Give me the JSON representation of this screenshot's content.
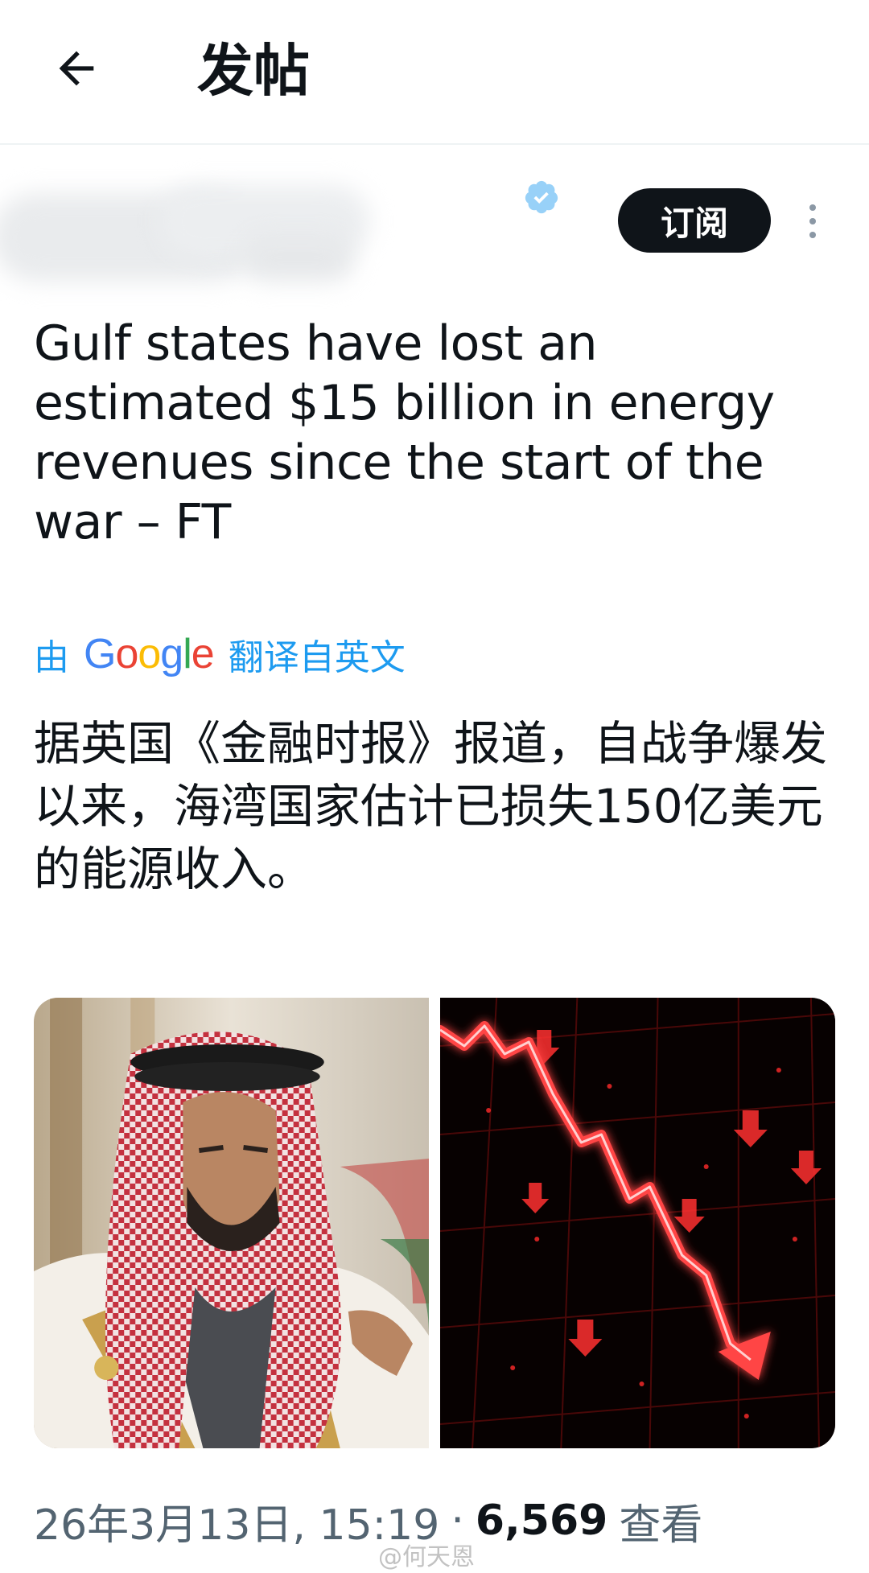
{
  "header": {
    "title": "发帖",
    "back_icon": "arrow-left-icon"
  },
  "author": {
    "subscribe_label": "订阅",
    "more_icon": "more-vertical-icon",
    "verified_icon": "verified-badge-icon"
  },
  "tweet": {
    "text": "Gulf states have lost an estimated $15 billion in energy revenues since the start of the war – FT",
    "translation_prefix": "由",
    "translation_provider": "Google",
    "translation_suffix": "翻译自英文",
    "translated_text": "据英国《金融时报》报道，自战争爆发以来，海湾国家估计已损失150亿美元的能源收入。"
  },
  "media": {
    "images": [
      "portrait-photo",
      "falling-red-chart-photo"
    ]
  },
  "meta": {
    "timestamp": "26年3月13日, 15:19",
    "separator": "·",
    "views_count": "6,569",
    "views_label": "查看"
  },
  "watermark": "@何天恩",
  "colors": {
    "link_blue": "#1d9bf0",
    "text_primary": "#0f1419",
    "text_secondary": "#536471",
    "button_dark": "#0f1419"
  }
}
